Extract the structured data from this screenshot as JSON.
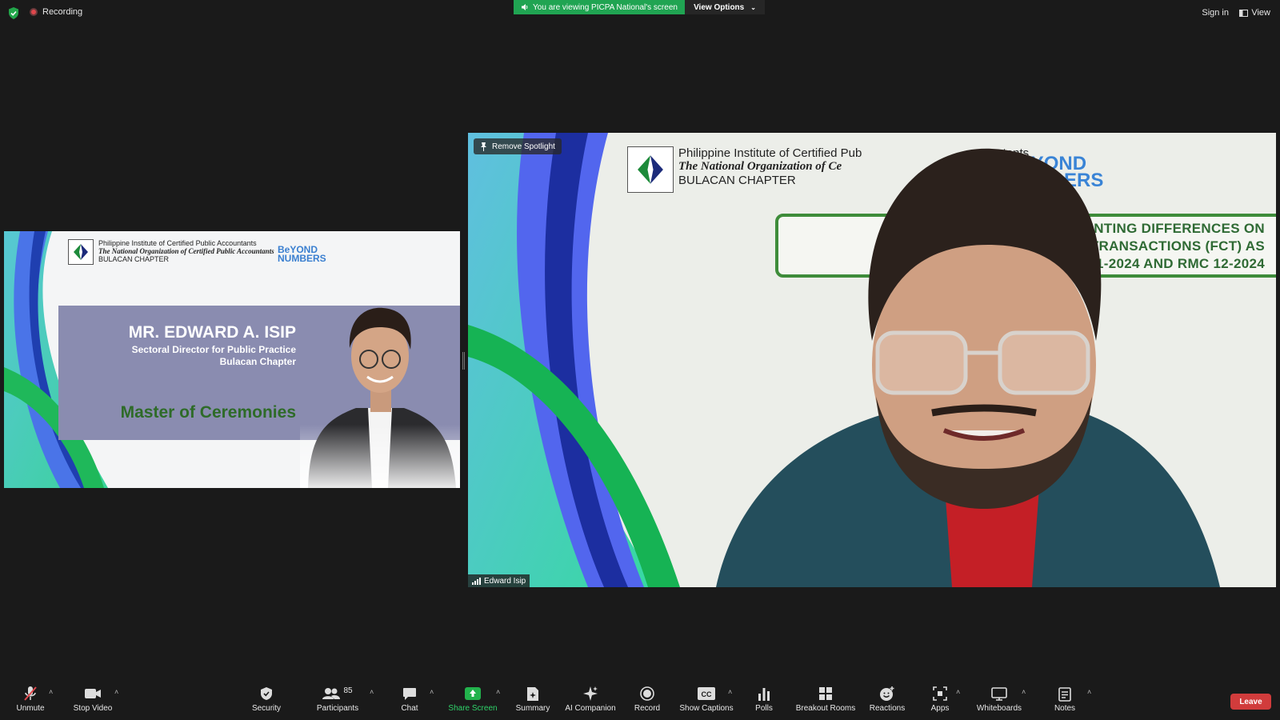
{
  "topbar": {
    "recording_label": "Recording",
    "viewing_label": "You are viewing PICPA National's screen",
    "view_options_label": "View Options",
    "sign_in_label": "Sign in",
    "view_label": "View"
  },
  "left_slide": {
    "org_line1": "Philippine Institute of Certified Public Accountants",
    "org_line2": "The National Organization of Certified Public Accountants",
    "org_line3": "BULACAN CHAPTER",
    "beyond_logo": "BeYOND NUMBERS",
    "mc_name": "MR. EDWARD A. ISIP",
    "mc_title_line1": "Sectoral Director for Public Practice",
    "mc_title_line2": "Bulacan Chapter",
    "mc_role": "Master of Ceremonies"
  },
  "right_tile": {
    "remove_spotlight_label": "Remove Spotlight",
    "participant_name": "Edward Isip",
    "org_line1": "Philippine Institute of Certified Pub",
    "org_line1_tail": "ntants",
    "org_line2": "The National Organization of Ce",
    "org_line3": "BULACAN CHAPTER",
    "beyond_logo": "BeYOND NUMBERS",
    "topic_line1": "ACCOUNTING DIFFERENCES ON",
    "topic_line2": "NCY TRANSACTIONS (FCT) AS",
    "topic_line3": "MC 11-2024 AND RMC 12-2024"
  },
  "toolbar": {
    "unmute": "Unmute",
    "stop_video": "Stop Video",
    "security": "Security",
    "participants": "Participants",
    "participants_count": "85",
    "chat": "Chat",
    "share_screen": "Share Screen",
    "summary": "Summary",
    "ai_companion": "AI Companion",
    "record": "Record",
    "show_captions": "Show Captions",
    "polls": "Polls",
    "breakout_rooms": "Breakout Rooms",
    "reactions": "Reactions",
    "apps": "Apps",
    "whiteboards": "Whiteboards",
    "notes": "Notes",
    "leave": "Leave"
  },
  "colors": {
    "background": "#1a1a1a",
    "viewing_green": "#20a452",
    "leave_red": "#d13c3c",
    "mc_band": "#8a8cb0",
    "slide_green": "#2e6b28"
  }
}
